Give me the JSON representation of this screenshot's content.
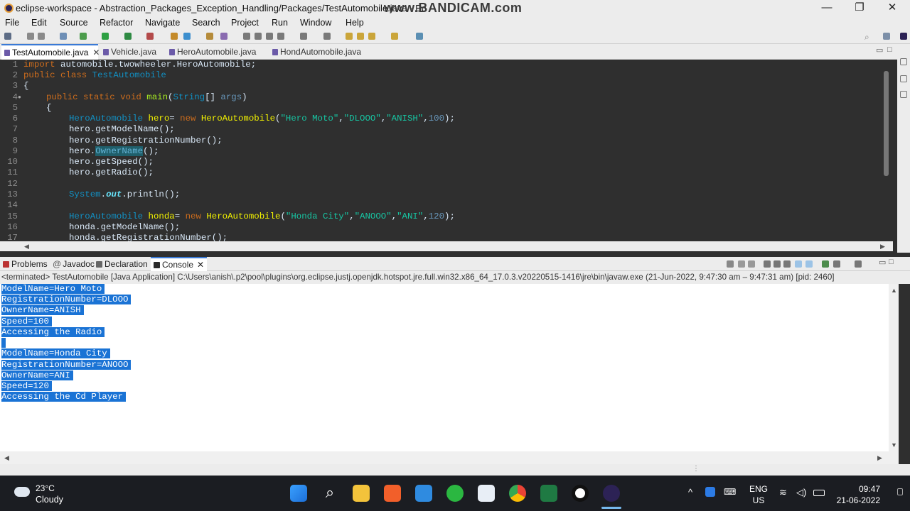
{
  "window": {
    "title": "eclipse-workspace - Abstraction_Packages_Exception_Handling/Packages/TestAutomobile.java - Ec",
    "watermark": "www.BANDICAM.com",
    "minimize": "—",
    "restore": "❐",
    "close": "✕"
  },
  "menu": [
    "File",
    "Edit",
    "Source",
    "Refactor",
    "Navigate",
    "Search",
    "Project",
    "Run",
    "Window",
    "Help"
  ],
  "editor_tabs": [
    {
      "label": "TestAutomobile.java",
      "close": "✕"
    },
    {
      "label": "Vehicle.java"
    },
    {
      "label": "HeroAutomobile.java"
    },
    {
      "label": "HondAutomobile.java"
    }
  ],
  "code": {
    "line_numbers": [
      "1",
      "2",
      "3",
      "4",
      "5",
      "6",
      "7",
      "8",
      "9",
      "10",
      "11",
      "12",
      "13",
      "14",
      "15",
      "16",
      "17"
    ],
    "l1_kw": "import",
    "l1_rest": " automobile.twowheeler.HeroAutomobile;",
    "l2_kw": "public class",
    "l2_type": "TestAutomobile",
    "l3": "{",
    "l4_kw": "public static void",
    "l4_m": "main",
    "l4_p1": "(",
    "l4_type": "String",
    "l4_p2": "[] ",
    "l4_args": "args",
    "l4_p3": ")",
    "l5": "{",
    "l6_type": "HeroAutomobile",
    "l6_var": "hero",
    "l6_eq": "= ",
    "l6_new": "new",
    "l6_ctor": "HeroAutomobile",
    "l6_p1": "(",
    "l6_s1": "\"Hero Moto\"",
    "l6_c1": ",",
    "l6_s2": "\"DLOOO\"",
    "l6_c2": ",",
    "l6_s3": "\"ANISH\"",
    "l6_c3": ",",
    "l6_n": "100",
    "l6_p2": ");",
    "l7": "hero.getModelName();",
    "l8": "hero.getRegistrationNumber();",
    "l9_a": "hero.",
    "l9_hl": "OwnerName",
    "l9_b": "();",
    "l10": "hero.getSpeed();",
    "l11": "hero.getRadio();",
    "l13_type": "System",
    "l13_dot": ".",
    "l13_out": "out",
    "l13_rest": ".println();",
    "l15_type": "HeroAutomobile",
    "l15_var": "honda",
    "l15_eq": "= ",
    "l15_new": "new",
    "l15_ctor": "HeroAutomobile",
    "l15_p1": "(",
    "l15_s1": "\"Honda City\"",
    "l15_c1": ",",
    "l15_s2": "\"ANOOO\"",
    "l15_c2": ",",
    "l15_s3": "\"ANI\"",
    "l15_c3": ",",
    "l15_n": "120",
    "l15_p2": ");",
    "l16": "honda.getModelName();",
    "l17": "honda.getRegistrationNumber();"
  },
  "panel_tabs": [
    {
      "label": "Problems"
    },
    {
      "label": "Javadoc"
    },
    {
      "label": "Declaration"
    },
    {
      "label": "Console",
      "close": "✕"
    }
  ],
  "console_status": "<terminated> TestAutomobile [Java Application] C:\\Users\\anish\\.p2\\pool\\plugins\\org.eclipse.justj.openjdk.hotspot.jre.full.win32.x86_64_17.0.3.v20220515-1416\\jre\\bin\\javaw.exe  (21-Jun-2022, 9:47:30 am – 9:47:31 am) [pid: 2460]",
  "console_lines": [
    "ModelName=Hero Moto",
    "RegistrationNumber=DLOOO",
    "OwnerName=ANISH",
    "Speed=100",
    "Accessing the Radio",
    "",
    "ModelName=Honda City",
    "RegistrationNumber=ANOOO",
    "OwnerName=ANI",
    "Speed=120",
    "Accessing the Cd Player"
  ],
  "taskbar": {
    "temperature": "23°C",
    "weather": "Cloudy",
    "lang_1": "ENG",
    "lang_2": "US",
    "time": "09:47",
    "date": "21-06-2022",
    "apps": [
      "windows-start",
      "search",
      "file-explorer",
      "brave",
      "microsoft-store",
      "whatsapp",
      "notepad-app",
      "chrome",
      "excel",
      "bandicam-record",
      "eclipse"
    ]
  },
  "colors": {
    "keyword": "#cc6c1d",
    "type": "#1290c3",
    "string": "#17c6a3",
    "selection": "#1a73d5"
  }
}
